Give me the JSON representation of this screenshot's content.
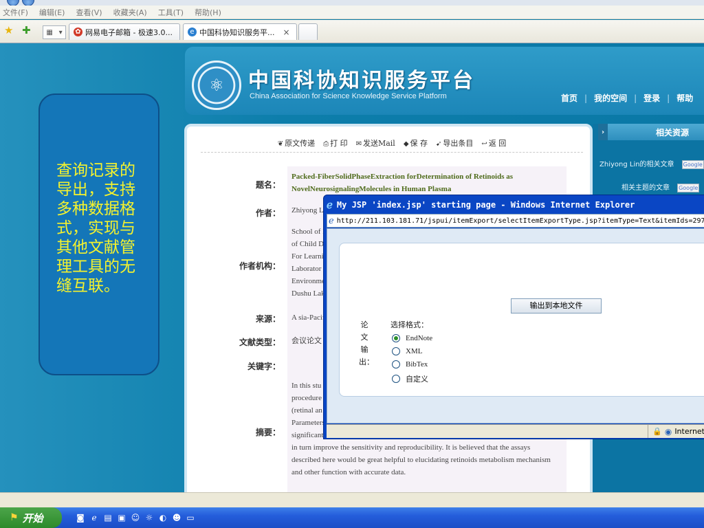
{
  "browser": {
    "menu": [
      "文件(F)",
      "编辑(E)",
      "查看(V)",
      "收藏夹(A)",
      "工具(T)",
      "帮助(H)"
    ],
    "tabs": [
      {
        "label": "网易电子邮箱 - 极速3.0...",
        "active": false
      },
      {
        "label": "中国科协知识服务平...",
        "active": true
      }
    ],
    "tab_close": "×",
    "quick_tabs_icon": "quick-tabs-icon"
  },
  "callout": {
    "text": "查询记录的导出，支持多种数据格式，实现与其他文献管理工具的无缝互联。"
  },
  "site": {
    "title": "中国科协知识服务平台",
    "subtitle": "China Association for Science Knowledge Service Platform",
    "nav": [
      "首页",
      "我的空间",
      "登录",
      "帮助"
    ]
  },
  "toolbar": [
    "原文传递",
    "打 印",
    "发送Mail",
    "保 存",
    "导出条目",
    "返 回"
  ],
  "record": {
    "labels": {
      "title": "题名：",
      "author": "作者：",
      "affiliation": "作者机构：",
      "source": "来源：",
      "doc_type": "文献类型：",
      "keywords": "关键字：",
      "abstract": "摘要："
    },
    "title": "Packed-FiberSolidPhaseExtraction forDetermination of Retinoids as NovelNeurosignalingMolecules in Human Plasma",
    "author": "Zhiyong L",
    "affiliation": [
      "School of B",
      "of Child D",
      "For Learni",
      "Laborator",
      "Environme",
      "Dushu Lak"
    ],
    "source": "A sia-Pacif",
    "doc_type": "会议论文",
    "abstract_lines": [
      "In this stu",
      "procedure",
      "(retinal an",
      "Parameters",
      "significant",
      "in turn improve the sensitivity and reproducibility. It is believed that the assays",
      "described here would be great helpful to elucidating retinoids metabolism mechanism",
      "and other function with accurate data."
    ]
  },
  "side": {
    "header": "相关资源",
    "row1": "Zhiyong Lin的相关文章",
    "row2": "相关主题的文章",
    "google": "Google"
  },
  "popup": {
    "title": "My JSP 'index.jsp' starting page - Windows Internet Explorer",
    "url": "http://211.103.181.71/jspui/itemExport/selectItemExportType.jsp?itemType=Text&itemIds=2974",
    "export_button": "输出到本地文件",
    "vertical_label": "论文输出：",
    "format_label": "选择格式：",
    "formats": [
      {
        "label": "EndNote",
        "selected": true
      },
      {
        "label": "XML",
        "selected": false
      },
      {
        "label": "BibTex",
        "selected": false
      },
      {
        "label": "自定义",
        "selected": false
      }
    ],
    "status_zone": "Internet"
  },
  "taskbar": {
    "start": "开始"
  }
}
